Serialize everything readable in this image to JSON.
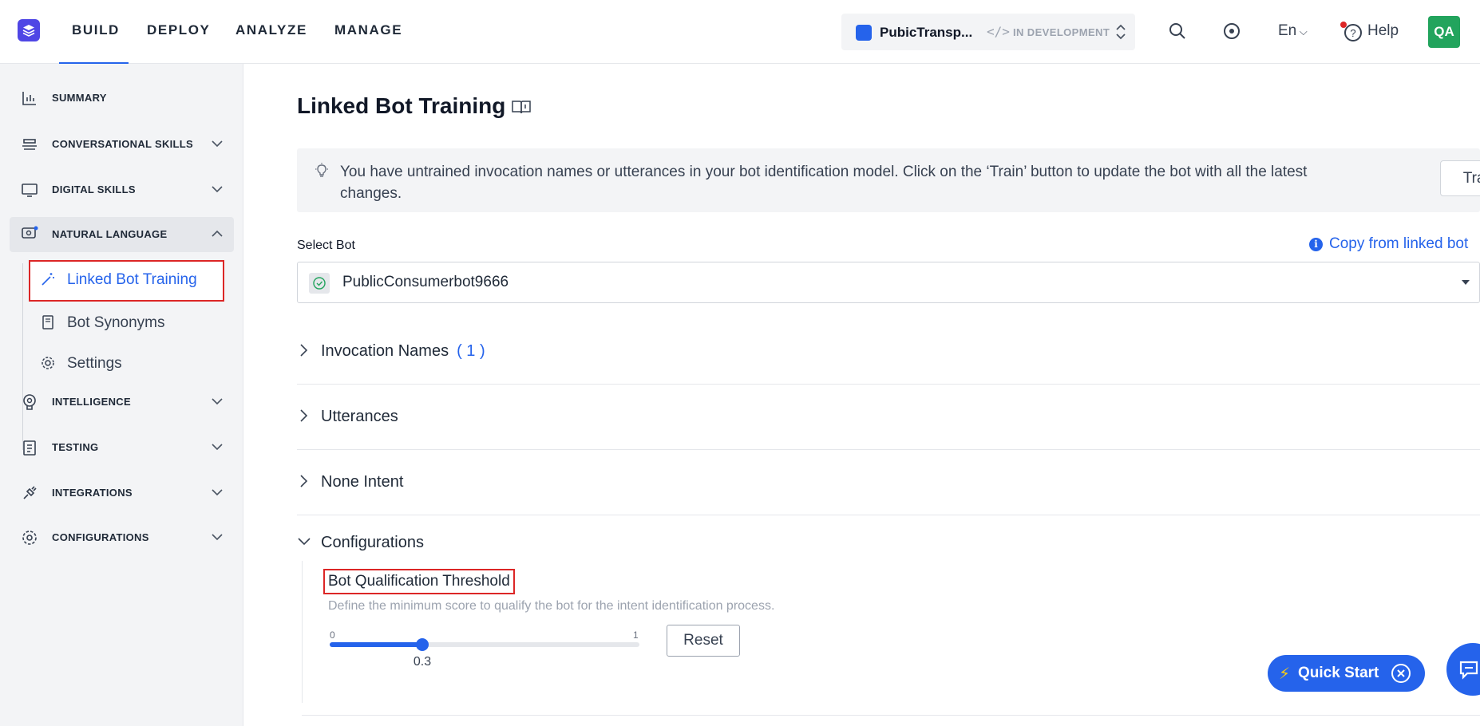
{
  "topnav": {
    "items": [
      "BUILD",
      "DEPLOY",
      "ANALYZE",
      "MANAGE"
    ],
    "active_item": "BUILD"
  },
  "app_switcher": {
    "name": "PubicTransp...",
    "status": "IN DEVELOPMENT"
  },
  "header_right": {
    "language": "En",
    "help_label": "Help",
    "avatar_initials": "QA"
  },
  "sidebar": {
    "items": [
      {
        "label": "SUMMARY",
        "icon": "bar-chart-icon"
      },
      {
        "label": "CONVERSATIONAL SKILLS",
        "icon": "layers-icon"
      },
      {
        "label": "DIGITAL SKILLS",
        "icon": "monitor-icon"
      },
      {
        "label": "NATURAL LANGUAGE",
        "icon": "speech-icon"
      },
      {
        "label": "INTELLIGENCE",
        "icon": "brain-icon"
      },
      {
        "label": "TESTING",
        "icon": "clipboard-icon"
      },
      {
        "label": "INTEGRATIONS",
        "icon": "plug-icon"
      },
      {
        "label": "CONFIGURATIONS",
        "icon": "cogs-icon"
      }
    ],
    "sub_items": [
      {
        "label": "Linked Bot Training",
        "icon": "magic-wand-icon"
      },
      {
        "label": "Bot Synonyms",
        "icon": "book-icon"
      },
      {
        "label": "Settings",
        "icon": "gear-icon"
      }
    ]
  },
  "main": {
    "title": "Linked Bot Training",
    "banner_text": "You have untrained invocation names or utterances in your bot identification model. Click on the ‘Train’ button to update the bot with all the latest changes.",
    "train_label": "Train",
    "select_label": "Select Bot",
    "copy_link": "Copy from linked bot",
    "selected_bot": "PublicConsumerbot9666",
    "accordions": [
      {
        "title": "Invocation Names",
        "count": "( 1 )"
      },
      {
        "title": "Utterances",
        "count": ""
      },
      {
        "title": "None Intent",
        "count": ""
      }
    ],
    "configurations_title": "Configurations",
    "threshold_label": "Bot Qualification Threshold",
    "threshold_desc": "Define the minimum score to qualify the bot for the intent identification process.",
    "slider": {
      "min": "0",
      "max": "1",
      "value": "0.3",
      "fraction": 0.3
    },
    "reset_label": "Reset"
  },
  "quick_start": {
    "label": "Quick Start"
  },
  "colors": {
    "accent": "#2563eb",
    "highlight": "#dc2626",
    "avatar": "#22a45d",
    "brand": "#4f46e5"
  }
}
